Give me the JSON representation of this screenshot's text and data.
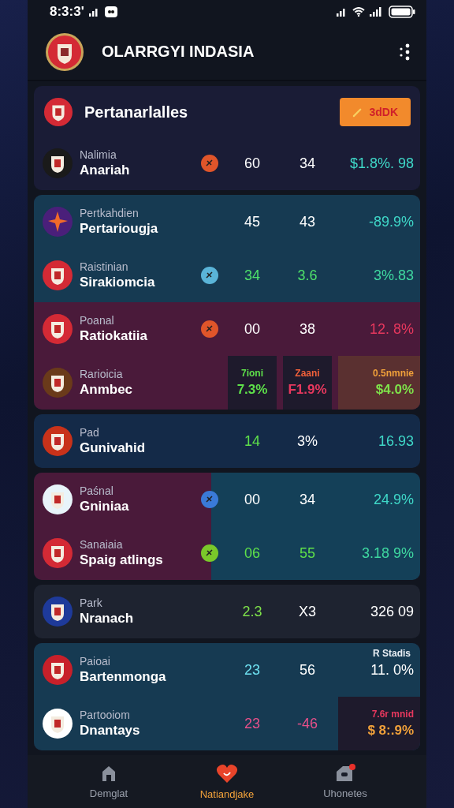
{
  "status_bar": {
    "time": "8:3:3'"
  },
  "app_bar": {
    "title": "OLARRGYI INDASIA"
  },
  "cards": [
    {
      "header": {
        "title": "Pertanarlalles",
        "logo": {
          "kind": "shield",
          "color": "#d42a35"
        },
        "button": "3dDK"
      },
      "rows": [
        {
          "kind": "plain",
          "subtitle": "Nalimia",
          "name": "Anariah",
          "logo": {
            "kind": "shield",
            "color": "#1a1a1a"
          },
          "badge": {
            "color": "#e0552a"
          },
          "values": [
            {
              "kind": "plain",
              "text": "60",
              "color": "#ffffff"
            },
            {
              "kind": "plain",
              "text": "34",
              "color": "#ffffff"
            },
            {
              "kind": "plain",
              "text": "$1.8%. 98",
              "color": "#3fd8c8"
            }
          ]
        }
      ]
    },
    {
      "rows": [
        {
          "kind": "teal",
          "subtitle": "Pertkahdien",
          "name": "Pertariougja",
          "logo": {
            "kind": "star",
            "color": "#4a1f7a"
          },
          "values": [
            {
              "kind": "plain",
              "text": "45",
              "color": "#ffffff"
            },
            {
              "kind": "plain",
              "text": "43",
              "color": "#ffffff"
            },
            {
              "kind": "plain",
              "text": "-89.9%",
              "color": "#3fd8c8"
            }
          ]
        },
        {
          "kind": "teal",
          "subtitle": "Raistinian",
          "name": "Sirakiomcia",
          "logo": {
            "kind": "shield",
            "color": "#d42a35"
          },
          "badge": {
            "color": "#5ab4d8"
          },
          "values": [
            {
              "kind": "plain",
              "text": "34",
              "color": "#4ee06a"
            },
            {
              "kind": "plain",
              "text": "3.6",
              "color": "#4ee06a"
            },
            {
              "kind": "plain",
              "text": "3%.83",
              "color": "#3fd8a0"
            }
          ]
        },
        {
          "kind": "maroon",
          "subtitle": "Poanal",
          "name": "Ratiokatiia",
          "logo": {
            "kind": "shield",
            "color": "#d42a35"
          },
          "badge": {
            "color": "#e0552a"
          },
          "values": [
            {
              "kind": "plain",
              "text": "00",
              "color": "#ffffff"
            },
            {
              "kind": "plain",
              "text": "38",
              "color": "#ffffff"
            },
            {
              "kind": "plain",
              "text": "12. 8%",
              "color": "#e8385e"
            }
          ]
        },
        {
          "kind": "maroon",
          "subtitle": "Rarioicia",
          "name": "Anmbec",
          "logo": {
            "kind": "shield",
            "color": "#6a3a1a"
          },
          "values": [
            {
              "kind": "boxed",
              "label": {
                "text": "7ioni",
                "color": "#5ee04a"
              },
              "text": "7.3%",
              "color": "#5ee04a"
            },
            {
              "kind": "boxed",
              "label": {
                "text": "Zaani",
                "color": "#f0603a"
              },
              "text": "F1.9%",
              "color": "#e8385e"
            },
            {
              "kind": "warmbox",
              "label": {
                "text": "0.5nmnie",
                "color": "#f0a03a"
              },
              "text": "$4.0%",
              "color": "#7ee04a"
            }
          ]
        }
      ]
    },
    {
      "rows": [
        {
          "kind": "navy",
          "subtitle": "Pad",
          "name": "Gunivahid",
          "logo": {
            "kind": "shield",
            "color": "#c8321a"
          },
          "values": [
            {
              "kind": "plain",
              "text": "14",
              "color": "#5ee04a"
            },
            {
              "kind": "plain",
              "text": "3%",
              "color": "#ffffff"
            },
            {
              "kind": "plain",
              "text": "16.93",
              "color": "#3fd8c8"
            }
          ]
        }
      ]
    },
    {
      "rows": [
        {
          "kind": "split",
          "subtitle": "Paśnal",
          "name": "Gniniaa",
          "logo": {
            "kind": "shield",
            "color": "#e8f4fa"
          },
          "badge": {
            "color": "#3a7ad8"
          },
          "values": [
            {
              "kind": "plain",
              "text": "00",
              "color": "#ffffff"
            },
            {
              "kind": "plain",
              "text": "34",
              "color": "#ffffff"
            },
            {
              "kind": "plain",
              "text": "24.9%",
              "color": "#3fd8c8"
            }
          ]
        },
        {
          "kind": "split",
          "subtitle": "Sanaiaia",
          "name": "Spaig atlings",
          "logo": {
            "kind": "shield",
            "color": "#d42a35"
          },
          "badge": {
            "color": "#7ac82a"
          },
          "values": [
            {
              "kind": "plain",
              "text": "06",
              "color": "#5ee04a"
            },
            {
              "kind": "plain",
              "text": "55",
              "color": "#5ee04a"
            },
            {
              "kind": "plain",
              "text": "3.18 9%",
              "color": "#3fd8a0"
            }
          ]
        }
      ]
    },
    {
      "rows": [
        {
          "kind": "gray",
          "subtitle": "Park",
          "name": "Nranach",
          "logo": {
            "kind": "shield",
            "color": "#1e3a9a"
          },
          "values": [
            {
              "kind": "plain",
              "text": "2.3",
              "color": "#7ee04a"
            },
            {
              "kind": "plain",
              "text": "X3",
              "color": "#ffffff"
            },
            {
              "kind": "plain",
              "text": "326 09",
              "color": "#ffffff"
            }
          ]
        }
      ]
    },
    {
      "corner_label": "R Stadis",
      "rows": [
        {
          "kind": "teal",
          "subtitle": "Paioai",
          "name": "Bartenmonga",
          "logo": {
            "kind": "shield",
            "color": "#c8202a"
          },
          "values": [
            {
              "kind": "plain",
              "text": "23",
              "color": "#6ee0f0"
            },
            {
              "kind": "plain",
              "text": "56",
              "color": "#ffffff"
            },
            {
              "kind": "plain",
              "text": "11. 0%",
              "color": "#ffffff"
            }
          ]
        },
        {
          "kind": "teal",
          "subtitle": "Partooiom",
          "name": "Dnantays",
          "logo": {
            "kind": "shield",
            "color": "#ffffff"
          },
          "values": [
            {
              "kind": "plain",
              "text": "23",
              "color": "#e8508a"
            },
            {
              "kind": "plain",
              "text": "-46",
              "color": "#e8508a"
            },
            {
              "kind": "boxed",
              "label": {
                "text": "7.6r mnid",
                "color": "#e8385e"
              },
              "text": "$ 8:.9%",
              "color": "#f0a03a"
            }
          ]
        }
      ]
    }
  ],
  "bottom_nav": [
    {
      "kind": "home",
      "label": "Demglat",
      "selected": false
    },
    {
      "kind": "heart",
      "label": "Natiandjake",
      "selected": true
    },
    {
      "kind": "tag",
      "label": "Uhonetes",
      "selected": false
    }
  ]
}
